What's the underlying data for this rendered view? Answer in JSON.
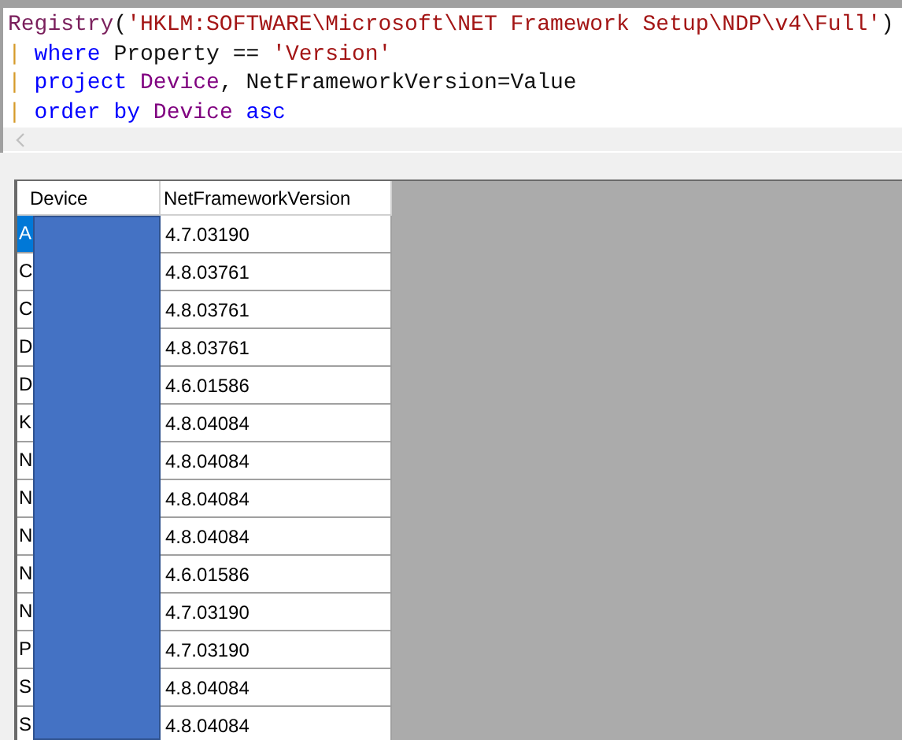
{
  "editor": {
    "lines": [
      {
        "tokens": [
          {
            "text": "Registry",
            "kind": "function"
          },
          {
            "text": "(",
            "kind": "plain"
          },
          {
            "text": "'HKLM:SOFTWARE\\Microsoft\\NET Framework Setup\\NDP\\v4\\Full'",
            "kind": "string"
          },
          {
            "text": ")",
            "kind": "plain"
          }
        ]
      },
      {
        "tokens": [
          {
            "text": "|",
            "kind": "pipe"
          },
          {
            "text": " where",
            "kind": "keyword"
          },
          {
            "text": " Property == ",
            "kind": "plain"
          },
          {
            "text": "'Version'",
            "kind": "string"
          }
        ]
      },
      {
        "tokens": [
          {
            "text": "|",
            "kind": "pipe"
          },
          {
            "text": " project",
            "kind": "keyword"
          },
          {
            "text": " Device",
            "kind": "column"
          },
          {
            "text": ", NetFrameworkVersion=Value",
            "kind": "plain"
          }
        ]
      },
      {
        "tokens": [
          {
            "text": "|",
            "kind": "pipe"
          },
          {
            "text": " order by",
            "kind": "keyword"
          },
          {
            "text": " Device",
            "kind": "column"
          },
          {
            "text": " asc",
            "kind": "keyword"
          }
        ]
      }
    ]
  },
  "table": {
    "columns": [
      "Device",
      "NetFrameworkVersion"
    ],
    "rows": [
      {
        "cells": [
          "A",
          "4.7.03190"
        ],
        "selected": true
      },
      {
        "cells": [
          "C",
          "4.8.03761"
        ],
        "selected": false
      },
      {
        "cells": [
          "C",
          "4.8.03761"
        ],
        "selected": false
      },
      {
        "cells": [
          "D",
          "4.8.03761"
        ],
        "selected": false
      },
      {
        "cells": [
          "D",
          "4.6.01586"
        ],
        "selected": false
      },
      {
        "cells": [
          "K",
          "4.8.04084"
        ],
        "selected": false
      },
      {
        "cells": [
          "N",
          "4.8.04084"
        ],
        "selected": false
      },
      {
        "cells": [
          "N",
          "4.8.04084"
        ],
        "selected": false
      },
      {
        "cells": [
          "N",
          "4.8.04084"
        ],
        "selected": false
      },
      {
        "cells": [
          "N",
          "4.6.01586"
        ],
        "selected": false
      },
      {
        "cells": [
          "N",
          "4.7.03190"
        ],
        "selected": false
      },
      {
        "cells": [
          "P",
          "4.7.03190"
        ],
        "selected": false
      },
      {
        "cells": [
          "S",
          "4.8.04084"
        ],
        "selected": false
      },
      {
        "cells": [
          "S",
          "4.8.04084"
        ],
        "selected": false
      }
    ]
  }
}
